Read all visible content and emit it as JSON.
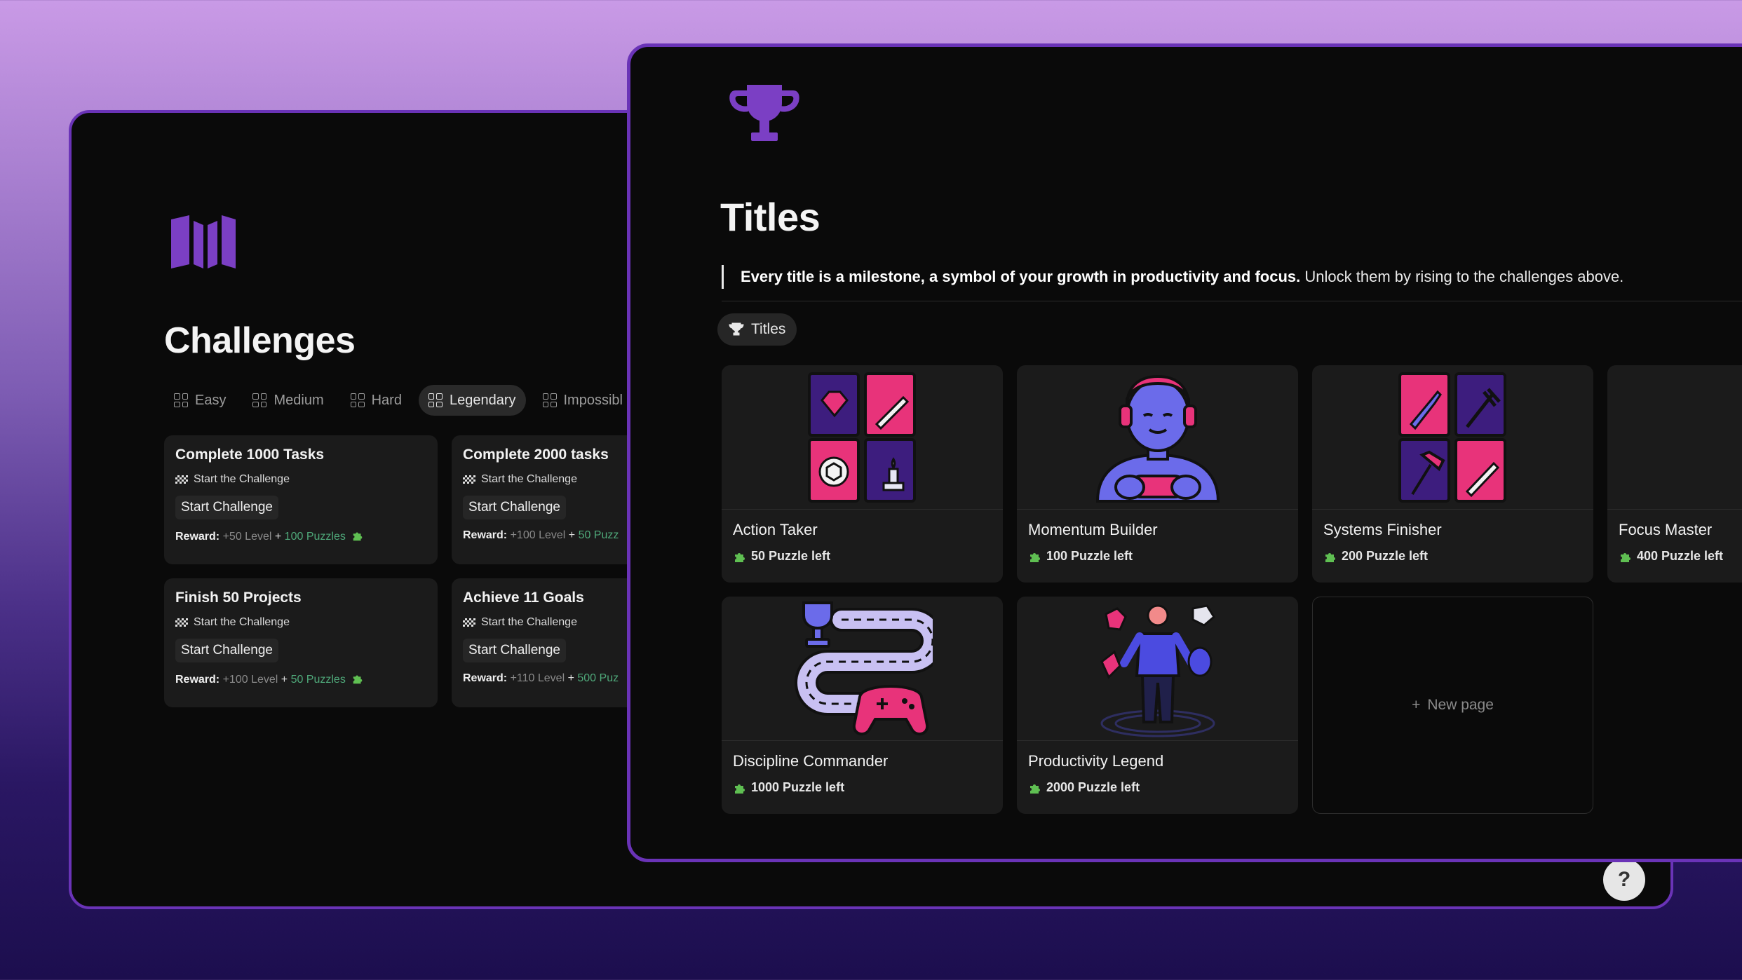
{
  "challenges": {
    "title": "Challenges",
    "tabs": [
      {
        "label": "Easy"
      },
      {
        "label": "Medium"
      },
      {
        "label": "Hard"
      },
      {
        "label": "Legendary"
      },
      {
        "label": "Impossibl"
      }
    ],
    "cards": [
      {
        "title": "Complete 1000 Tasks",
        "sub": "Start the Challenge",
        "button": "Start Challenge",
        "reward_label": "Reward:",
        "level": "+50 Level",
        "plus": "+",
        "puzzles": "100 Puzzles"
      },
      {
        "title": "Complete 2000 tasks",
        "sub": "Start the Challenge",
        "button": "Start Challenge",
        "reward_label": "Reward:",
        "level": "+100 Level",
        "plus": "+",
        "puzzles": "50 Puzz"
      },
      {
        "title": "Finish 50 Projects",
        "sub": "Start the Challenge",
        "button": "Start Challenge",
        "reward_label": "Reward:",
        "level": "+100 Level",
        "plus": "+",
        "puzzles": "50 Puzzles"
      },
      {
        "title": "Achieve 11 Goals",
        "sub": "Start the Challenge",
        "button": "Start Challenge",
        "reward_label": "Reward:",
        "level": "+110 Level",
        "plus": "+",
        "puzzles": "500 Puz"
      }
    ]
  },
  "titles": {
    "title": "Titles",
    "quote_strong": "Every title is a milestone, a symbol of your growth in productivity and focus.",
    "quote_rest": " Unlock them by rising to the challenges above.",
    "tab_label": "Titles",
    "cards": [
      {
        "name": "Action Taker",
        "meta": "50 Puzzle left",
        "icon": "card-grid-icon"
      },
      {
        "name": "Momentum Builder",
        "meta": "100 Puzzle left",
        "icon": "gamer-icon"
      },
      {
        "name": "Systems Finisher",
        "meta": "200 Puzzle left",
        "icon": "tools-grid-icon"
      },
      {
        "name": "Focus Master",
        "meta": "400 Puzzle left",
        "icon": "vr-person-icon"
      },
      {
        "name": "Discipline Commander",
        "meta": "1000 Puzzle left",
        "icon": "path-trophy-icon"
      },
      {
        "name": "Productivity Legend",
        "meta": "2000 Puzzle left",
        "icon": "juggler-icon"
      }
    ],
    "new_page_label": "New page"
  },
  "help_label": "?",
  "colors": {
    "accent": "#6a33b7",
    "pink": "#e8337a",
    "puzzle_green": "#4fa97a"
  }
}
